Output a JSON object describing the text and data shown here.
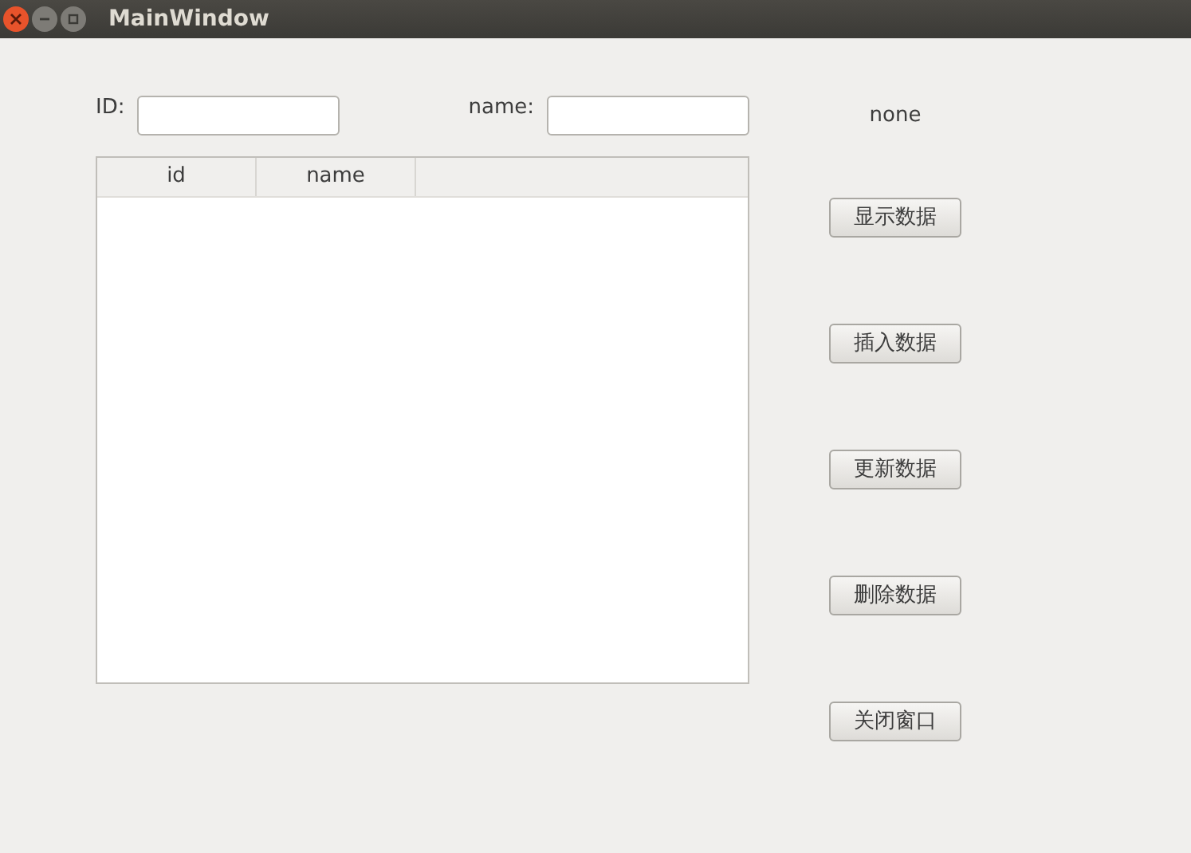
{
  "window": {
    "title": "MainWindow"
  },
  "fields": [
    {
      "label": "ID:"
    },
    {
      "label": "name:"
    }
  ],
  "table": {
    "columns": [
      "id",
      "name"
    ]
  },
  "status": "none",
  "buttons": [
    "显示数据",
    "插入数据",
    "更新数据",
    "删除数据",
    "关闭窗口"
  ]
}
